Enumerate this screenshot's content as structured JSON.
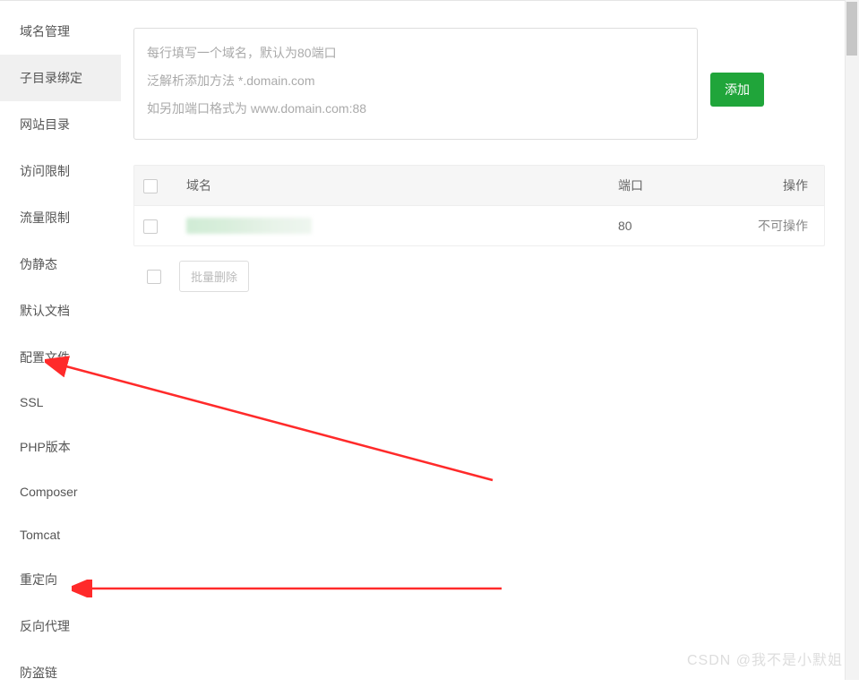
{
  "sidebar": {
    "items": [
      {
        "label": "域名管理"
      },
      {
        "label": "子目录绑定"
      },
      {
        "label": "网站目录"
      },
      {
        "label": "访问限制"
      },
      {
        "label": "流量限制"
      },
      {
        "label": "伪静态"
      },
      {
        "label": "默认文档"
      },
      {
        "label": "配置文件"
      },
      {
        "label": "SSL"
      },
      {
        "label": "PHP版本"
      },
      {
        "label": "Composer"
      },
      {
        "label": "Tomcat"
      },
      {
        "label": "重定向"
      },
      {
        "label": "反向代理"
      },
      {
        "label": "防盗链"
      }
    ],
    "active_index": 1
  },
  "domain_input": {
    "placeholder": "每行填写一个域名，默认为80端口\n泛解析添加方法 *.domain.com\n如另加端口格式为 www.domain.com:88",
    "value": ""
  },
  "buttons": {
    "add": "添加",
    "bulk_delete": "批量删除"
  },
  "table": {
    "headers": {
      "domain": "域名",
      "port": "端口",
      "action": "操作"
    },
    "rows": [
      {
        "domain_hidden": true,
        "port": "80",
        "action": "不可操作"
      }
    ]
  },
  "watermark": "CSDN @我不是小默姐"
}
